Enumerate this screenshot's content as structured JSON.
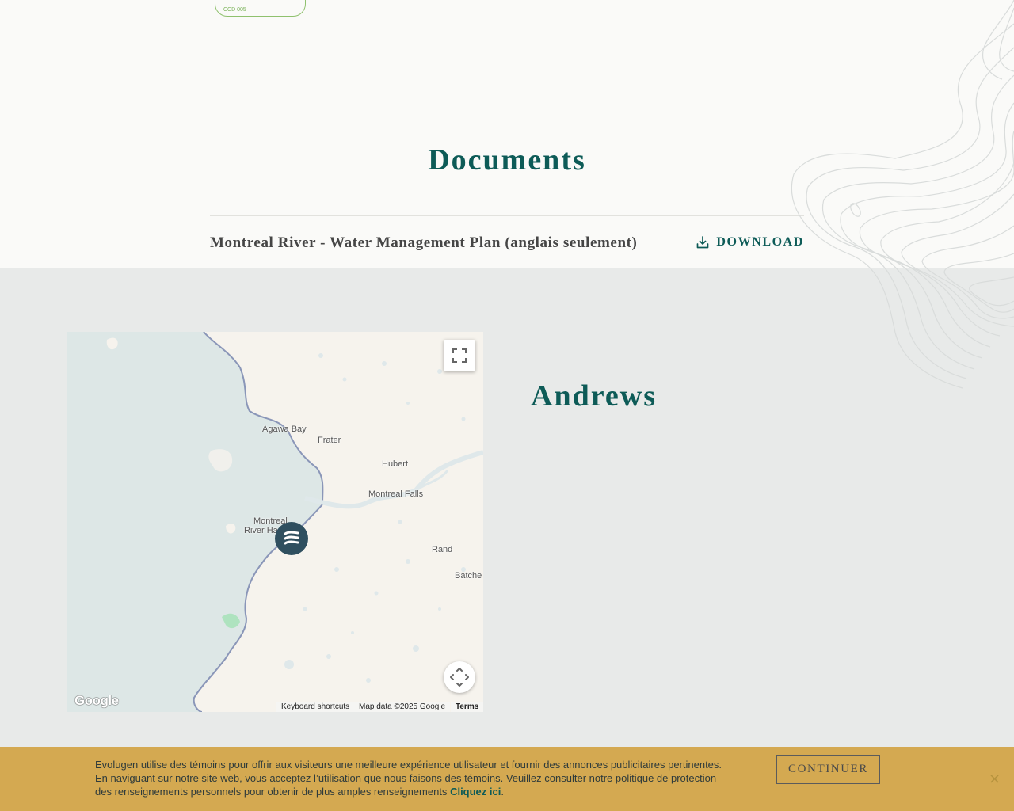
{
  "header": {
    "badge_text": "CCD 005"
  },
  "documents": {
    "title": "Documents",
    "items": [
      {
        "name": "Montreal River - Water Management Plan (anglais seulement)",
        "action_label": "DOWNLOAD"
      }
    ]
  },
  "location": {
    "title": "Andrews",
    "map": {
      "labels": {
        "agawa_bay": "Agawa Bay",
        "frater": "Frater",
        "hubert": "Hubert",
        "montreal_falls": "Montreal Falls",
        "montreal_river_harbour_line1": "Montreal",
        "montreal_river_harbour_line2": "River Ha",
        "rand": "Rand",
        "batchewana": "Batche"
      },
      "google_logo": "Google",
      "keyboard_shortcuts": "Keyboard shortcuts",
      "map_data": "Map data ©2025 Google",
      "terms": "Terms",
      "colors": {
        "water": "#dde7e6",
        "land": "#f6f3ed",
        "shoreline": "#8a96b8",
        "marker": "#2f4f5f",
        "park": "#aee3bf"
      }
    }
  },
  "cookie_banner": {
    "text": "Evolugen utilise des témoins pour offrir aux visiteurs une meilleure expérience utilisateur et fournir des annonces publicitaires pertinentes. En naviguant sur notre site web, vous acceptez l’utilisation que nous faisons des témoins. Veuillez consulter notre politique de protection des renseignements personnels pour obtenir de plus amples renseignements",
    "link_label": "Cliquez ici",
    "suffix": ".",
    "continue_label": "CONTINUER",
    "close_label": "×"
  },
  "colors": {
    "brand_green": "#0d5b57",
    "cookie_bg": "#d4a951",
    "section_bg": "#e8eae9"
  }
}
